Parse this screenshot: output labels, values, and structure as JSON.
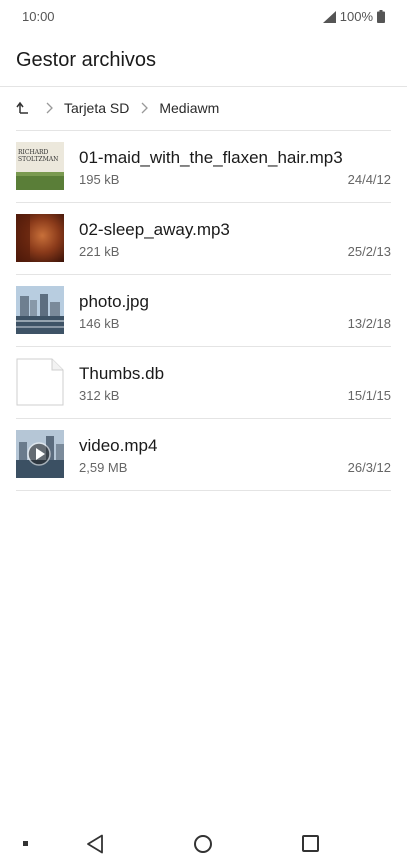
{
  "status": {
    "time": "10:00",
    "battery": "100%"
  },
  "app": {
    "title": "Gestor archivos"
  },
  "breadcrumb": {
    "items": [
      "Tarjeta SD",
      "Mediawm"
    ]
  },
  "files": [
    {
      "name": "01-maid_with_the_flaxen_hair.mp3",
      "size": "195 kB",
      "date": "24/4/12",
      "thumb": "album-cover",
      "thumb_text_1": "RICHARD",
      "thumb_text_2": "STOLTZMAN"
    },
    {
      "name": "02-sleep_away.mp3",
      "size": "221 kB",
      "date": "25/2/13",
      "thumb": "album-cover-dark"
    },
    {
      "name": "photo.jpg",
      "size": "146 kB",
      "date": "13/2/18",
      "thumb": "photo"
    },
    {
      "name": "Thumbs.db",
      "size": "312 kB",
      "date": "15/1/15",
      "thumb": "generic-file"
    },
    {
      "name": "video.mp4",
      "size": "2,59 MB",
      "date": "26/3/12",
      "thumb": "video"
    }
  ],
  "colors": {
    "divider": "#e4e4e4",
    "text_primary": "#1a1a1a",
    "text_secondary": "#666666"
  }
}
